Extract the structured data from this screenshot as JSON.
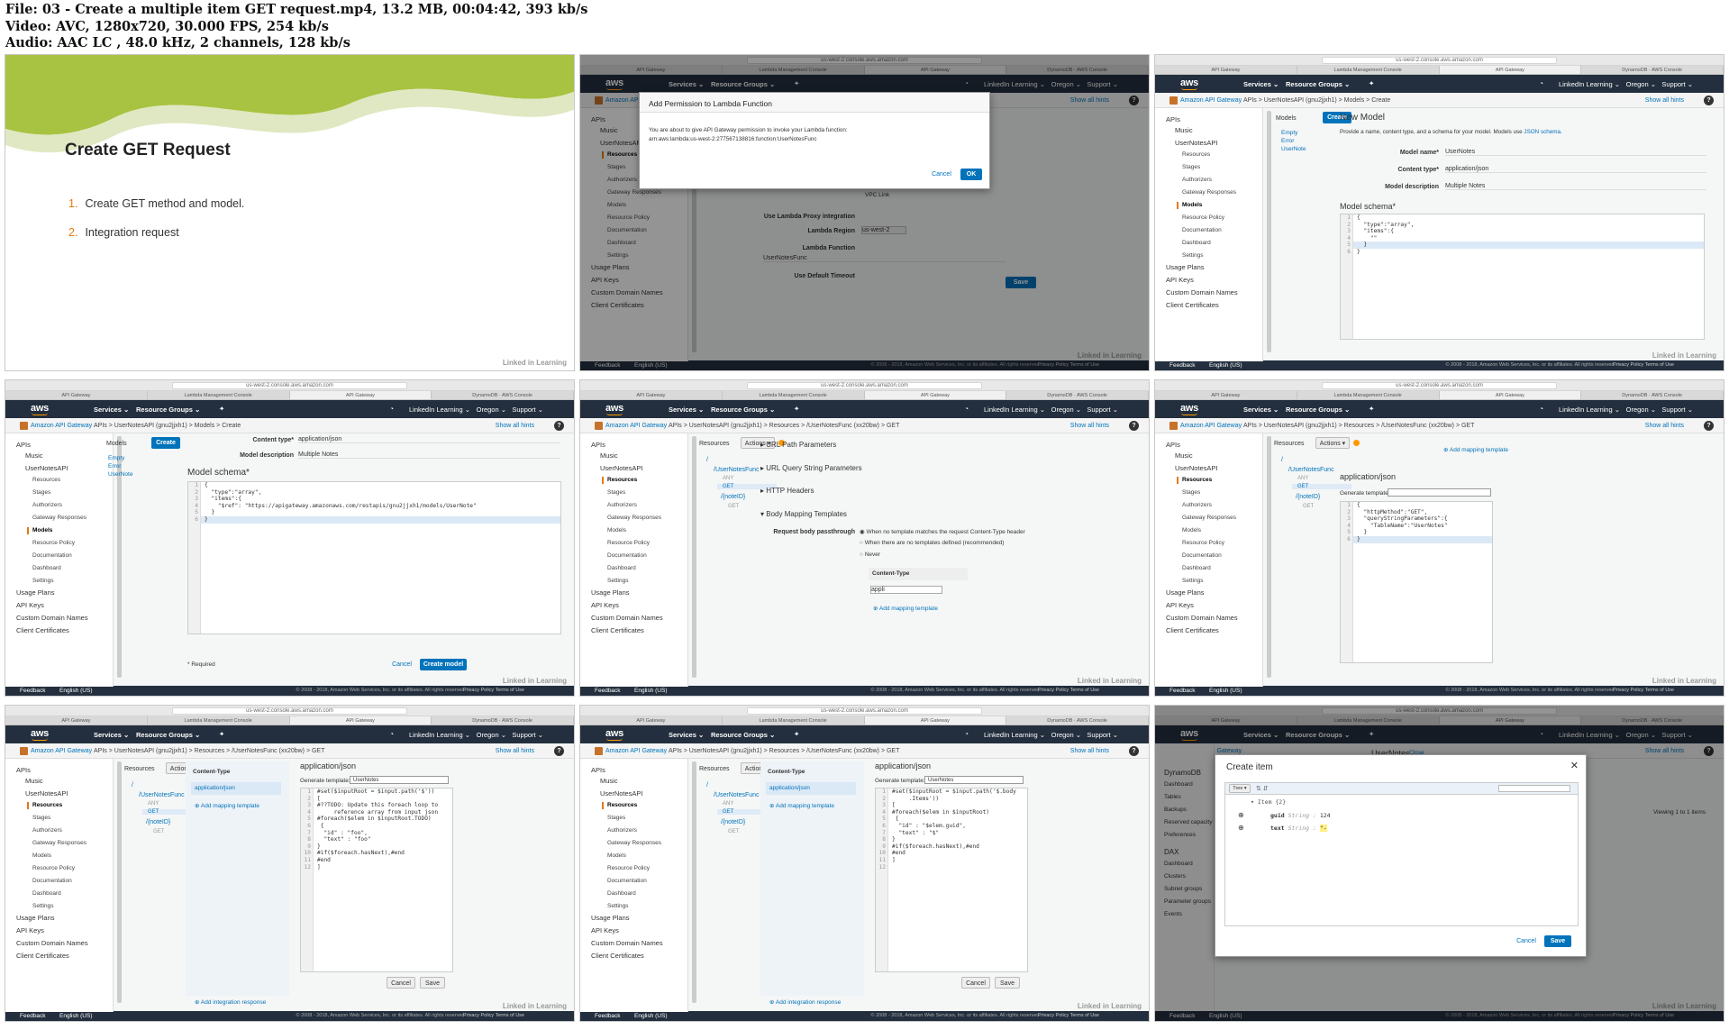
{
  "header": {
    "file_line": "File: 03 - Create a multiple item GET request.mp4, 13.2 MB, 00:04:42, 393 kb/s",
    "video_line": "Video: AVC, 1280x720, 30.000 FPS, 254 kb/s",
    "audio_line": "Audio: AAC LC , 48.0 kHz, 2 channels, 128 kb/s"
  },
  "browser": {
    "url": "us-west-2.console.aws.amazon.com",
    "tabs": [
      "API Gateway",
      "Lambda Management Console",
      "API Gateway",
      "DynamoDB · AWS Console"
    ]
  },
  "aws": {
    "logo": "aws",
    "services": "Services ⌄",
    "resource_groups": "Resource Groups ⌄",
    "pin": "✦",
    "bell": "🔔",
    "account": "LinkedIn Learning ⌄",
    "region": "Oregon ⌄",
    "support": "Support ⌄",
    "apigw": "Amazon API Gateway",
    "hints": "Show all hints",
    "help": "?",
    "feedback": "Feedback",
    "language": "English (US)",
    "copyright": "© 2008 - 2018, Amazon Web Services, Inc. or its affiliates. All rights reserved.",
    "privacy": "Privacy Policy   Terms of Use",
    "watermark": "Linked in Learning"
  },
  "sidebar": {
    "apis": "APIs",
    "music": "Music",
    "usernotes": "UserNotesAPI",
    "resources": "Resources",
    "stages": "Stages",
    "authorizers": "Authorizers",
    "gateway_responses": "Gateway Responses",
    "models": "Models",
    "resource_policy": "Resource Policy",
    "documentation": "Documentation",
    "dashboard": "Dashboard",
    "settings": "Settings",
    "usage_plans": "Usage Plans",
    "api_keys": "API Keys",
    "custom_domains": "Custom Domain Names",
    "client_certs": "Client Certificates"
  },
  "slide": {
    "title": "Create GET Request",
    "items": [
      {
        "n": "1.",
        "t": "Create GET method and model."
      },
      {
        "n": "2.",
        "t": "Integration request"
      }
    ]
  },
  "tile2": {
    "modal_title": "Add Permission to Lambda Function",
    "modal_text": "You are about to give API Gateway permission to invoke your Lambda function:",
    "modal_arn": "arn:aws:lambda:us-west-2:277567138816:function:UserNotesFunc",
    "cancel": "Cancel",
    "ok": "OK",
    "aws_service": "AWS Service",
    "vpc_link": "VPC Link",
    "proxy": "Use Lambda Proxy integration",
    "lregion": "Lambda Region",
    "lregion_val": "us-west-2",
    "lfunc": "Lambda Function",
    "lfunc_val": "UserNotesFunc",
    "timeout": "Use Default Timeout",
    "save": "Save"
  },
  "tile3": {
    "crumb": "APIs  >  UserNotesAPI (gnu2jjxh1)  >  Models  >  Create",
    "models": "Models",
    "create": "Create",
    "model_items": [
      "Empty",
      "Error",
      "UserNote"
    ],
    "heading": "New Model",
    "desc": "Provide a name, content type, and a schema for your model. Models use",
    "json_link": "JSON schema.",
    "name_lbl": "Model name*",
    "name_val": "UserNotes",
    "ct_lbl": "Content type*",
    "ct_val": "application/json",
    "md_lbl": "Model description",
    "md_val": "Multiple Notes",
    "schema": "Model schema*",
    "code": "{\n  \"type\":\"array\",\n  \"items\":{\n    \"\"\n  }\n}"
  },
  "tile4": {
    "ct_lbl": "Content type*",
    "ct_val": "application/json",
    "md_lbl": "Model description",
    "md_val": "Multiple Notes",
    "schema": "Model schema*",
    "code": "{\n  \"type\":\"array\",\n  \"items\":{\n    \"$ref\": \"https://apigateway.amazonaws.com/restapis/gnu2jjxh1/models/UserNote\"\n  }\n}",
    "required": "* Required",
    "cancel": "Cancel",
    "create_model": "Create model"
  },
  "resources": {
    "crumb": "APIs  >  UserNotesAPI (gnu2jjxh1)  >  Resources  >  /UserNotesFunc (xx20bw)  >  GET",
    "title": "Resources",
    "actions": "Actions ▾",
    "tree": [
      "/",
      "/UserNotesFunc",
      "ANY",
      "GET",
      "/{noteID}",
      "GET"
    ]
  },
  "tile5": {
    "sections": [
      "URL Path Parameters",
      "URL Query String Parameters",
      "HTTP Headers",
      "Body Mapping Templates"
    ],
    "passthrough": "Request body passthrough",
    "opts": [
      "When no template matches the request Content-Type header",
      "When there are no templates defined (recommended)",
      "Never"
    ],
    "ct_head": "Content-Type",
    "ct_input": "appli",
    "add_template": "Add mapping template"
  },
  "tile6": {
    "add_template": "Add mapping template",
    "ct_head": "application/json",
    "gen": "Generate template:",
    "code": "{\n  \"httpMethod\":\"GET\",\n  \"queryStringParameters\":{\n    \"TableName\":\"UserNotes\"\n  }\n}"
  },
  "tile7": {
    "ct_head": "Content-Type",
    "ct_item": "application/json",
    "add_template": "Add mapping template",
    "mt_title": "application/json",
    "gen": "Generate template:",
    "gen_val": "UserNotes",
    "code": "#set($inputRoot = $input.path('$'))\n[\n#??TODO: Update this foreach loop to\n     reference array from input json\n#foreach($elem in $inputRoot.TODO)\n {\n  \"id\" : \"foo\",\n  \"text\" : \"foo\"\n}\n#if($foreach.hasNext),#end\n#end\n]",
    "cancel": "Cancel",
    "save": "Save",
    "add_int": "Add integration response"
  },
  "tile8": {
    "code": "#set($inputRoot = $input.path('$.body\n     .Items'))\n[\n#foreach($elem in $inputRoot)\n {\n  \"id\" : \"$elem.guid\",\n  \"text\" : \"$\"\n}\n#if($foreach.hasNext),#end\n#end\n]"
  },
  "tile9": {
    "nav": [
      "DynamoDB",
      "Dashboard",
      "Tables",
      "Backups",
      "Reserved capacity",
      "Preferences",
      "DAX",
      "Dashboard",
      "Clusters",
      "Subnet groups",
      "Parameter groups",
      "Events"
    ],
    "table": "UserNotes",
    "close": "Close",
    "modal_title": "Create item",
    "tree_btn": "Tree ▾",
    "item_row": "▾ Item {2}",
    "f1_name": "guid",
    "f1_type": "String :",
    "f1_val": "124",
    "f2_name": "text",
    "f2_type": "String :",
    "f2_val": "\"-",
    "cancel": "Cancel",
    "save": "Save",
    "range": "Viewing 1 to 1 items"
  },
  "colors": {
    "awsnav": "#232f3e",
    "orange": "#e47911",
    "blue": "#0073bb",
    "slide_green": "#a8c241"
  }
}
